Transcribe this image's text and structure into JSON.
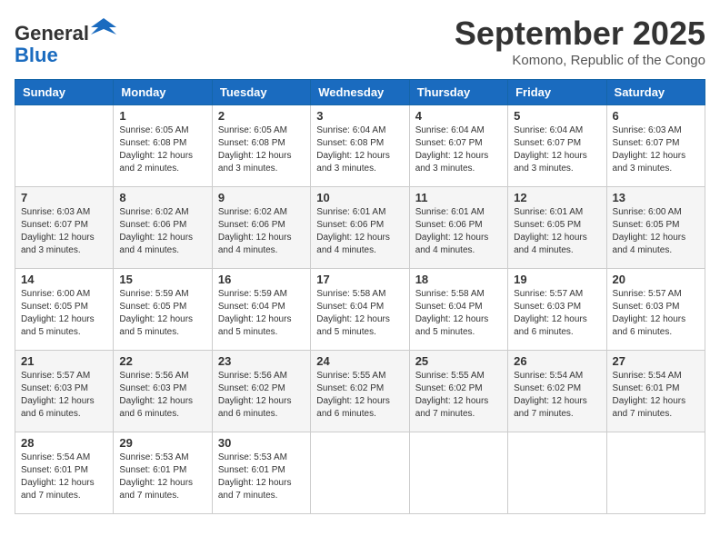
{
  "header": {
    "logo_line1": "General",
    "logo_line2": "Blue",
    "month": "September 2025",
    "location": "Komono, Republic of the Congo"
  },
  "weekdays": [
    "Sunday",
    "Monday",
    "Tuesday",
    "Wednesday",
    "Thursday",
    "Friday",
    "Saturday"
  ],
  "weeks": [
    [
      {
        "day": "",
        "info": ""
      },
      {
        "day": "1",
        "info": "Sunrise: 6:05 AM\nSunset: 6:08 PM\nDaylight: 12 hours\nand 2 minutes."
      },
      {
        "day": "2",
        "info": "Sunrise: 6:05 AM\nSunset: 6:08 PM\nDaylight: 12 hours\nand 3 minutes."
      },
      {
        "day": "3",
        "info": "Sunrise: 6:04 AM\nSunset: 6:08 PM\nDaylight: 12 hours\nand 3 minutes."
      },
      {
        "day": "4",
        "info": "Sunrise: 6:04 AM\nSunset: 6:07 PM\nDaylight: 12 hours\nand 3 minutes."
      },
      {
        "day": "5",
        "info": "Sunrise: 6:04 AM\nSunset: 6:07 PM\nDaylight: 12 hours\nand 3 minutes."
      },
      {
        "day": "6",
        "info": "Sunrise: 6:03 AM\nSunset: 6:07 PM\nDaylight: 12 hours\nand 3 minutes."
      }
    ],
    [
      {
        "day": "7",
        "info": "Sunrise: 6:03 AM\nSunset: 6:07 PM\nDaylight: 12 hours\nand 3 minutes."
      },
      {
        "day": "8",
        "info": "Sunrise: 6:02 AM\nSunset: 6:06 PM\nDaylight: 12 hours\nand 4 minutes."
      },
      {
        "day": "9",
        "info": "Sunrise: 6:02 AM\nSunset: 6:06 PM\nDaylight: 12 hours\nand 4 minutes."
      },
      {
        "day": "10",
        "info": "Sunrise: 6:01 AM\nSunset: 6:06 PM\nDaylight: 12 hours\nand 4 minutes."
      },
      {
        "day": "11",
        "info": "Sunrise: 6:01 AM\nSunset: 6:06 PM\nDaylight: 12 hours\nand 4 minutes."
      },
      {
        "day": "12",
        "info": "Sunrise: 6:01 AM\nSunset: 6:05 PM\nDaylight: 12 hours\nand 4 minutes."
      },
      {
        "day": "13",
        "info": "Sunrise: 6:00 AM\nSunset: 6:05 PM\nDaylight: 12 hours\nand 4 minutes."
      }
    ],
    [
      {
        "day": "14",
        "info": "Sunrise: 6:00 AM\nSunset: 6:05 PM\nDaylight: 12 hours\nand 5 minutes."
      },
      {
        "day": "15",
        "info": "Sunrise: 5:59 AM\nSunset: 6:05 PM\nDaylight: 12 hours\nand 5 minutes."
      },
      {
        "day": "16",
        "info": "Sunrise: 5:59 AM\nSunset: 6:04 PM\nDaylight: 12 hours\nand 5 minutes."
      },
      {
        "day": "17",
        "info": "Sunrise: 5:58 AM\nSunset: 6:04 PM\nDaylight: 12 hours\nand 5 minutes."
      },
      {
        "day": "18",
        "info": "Sunrise: 5:58 AM\nSunset: 6:04 PM\nDaylight: 12 hours\nand 5 minutes."
      },
      {
        "day": "19",
        "info": "Sunrise: 5:57 AM\nSunset: 6:03 PM\nDaylight: 12 hours\nand 6 minutes."
      },
      {
        "day": "20",
        "info": "Sunrise: 5:57 AM\nSunset: 6:03 PM\nDaylight: 12 hours\nand 6 minutes."
      }
    ],
    [
      {
        "day": "21",
        "info": "Sunrise: 5:57 AM\nSunset: 6:03 PM\nDaylight: 12 hours\nand 6 minutes."
      },
      {
        "day": "22",
        "info": "Sunrise: 5:56 AM\nSunset: 6:03 PM\nDaylight: 12 hours\nand 6 minutes."
      },
      {
        "day": "23",
        "info": "Sunrise: 5:56 AM\nSunset: 6:02 PM\nDaylight: 12 hours\nand 6 minutes."
      },
      {
        "day": "24",
        "info": "Sunrise: 5:55 AM\nSunset: 6:02 PM\nDaylight: 12 hours\nand 6 minutes."
      },
      {
        "day": "25",
        "info": "Sunrise: 5:55 AM\nSunset: 6:02 PM\nDaylight: 12 hours\nand 7 minutes."
      },
      {
        "day": "26",
        "info": "Sunrise: 5:54 AM\nSunset: 6:02 PM\nDaylight: 12 hours\nand 7 minutes."
      },
      {
        "day": "27",
        "info": "Sunrise: 5:54 AM\nSunset: 6:01 PM\nDaylight: 12 hours\nand 7 minutes."
      }
    ],
    [
      {
        "day": "28",
        "info": "Sunrise: 5:54 AM\nSunset: 6:01 PM\nDaylight: 12 hours\nand 7 minutes."
      },
      {
        "day": "29",
        "info": "Sunrise: 5:53 AM\nSunset: 6:01 PM\nDaylight: 12 hours\nand 7 minutes."
      },
      {
        "day": "30",
        "info": "Sunrise: 5:53 AM\nSunset: 6:01 PM\nDaylight: 12 hours\nand 7 minutes."
      },
      {
        "day": "",
        "info": ""
      },
      {
        "day": "",
        "info": ""
      },
      {
        "day": "",
        "info": ""
      },
      {
        "day": "",
        "info": ""
      }
    ]
  ]
}
